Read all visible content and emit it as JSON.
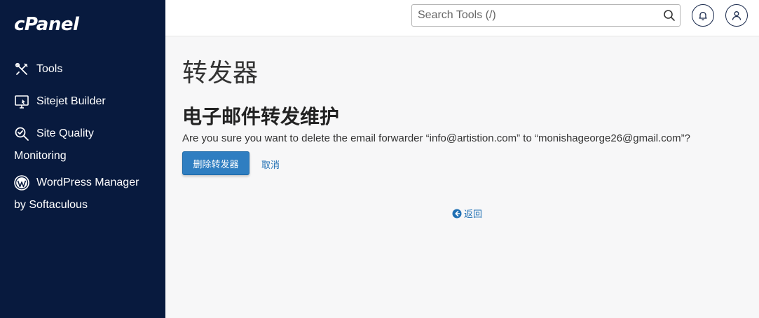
{
  "brand": {
    "logo_text": "cPanel"
  },
  "sidebar": {
    "items": [
      {
        "label": "Tools",
        "icon": "tools-icon"
      },
      {
        "label": "Sitejet Builder",
        "icon": "monitor-icon"
      },
      {
        "label": "Site Quality",
        "label_line2": "Monitoring",
        "icon": "magnifier-check-icon"
      },
      {
        "label": "WordPress Manager",
        "label_line2": "by Softaculous",
        "icon": "wordpress-icon"
      }
    ]
  },
  "header": {
    "search_placeholder": "Search Tools (/)",
    "icons": [
      "search-icon",
      "bell-icon",
      "user-icon"
    ]
  },
  "main": {
    "page_title": "转发器",
    "section_title": "电子邮件转发维护",
    "confirm_text": "Are you sure you want to delete the email forwarder “info@artistion.com” to “monishageorge26@gmail.com”?",
    "delete_button": "删除转发器",
    "cancel_link": "取消",
    "back_link": "返回"
  },
  "colors": {
    "sidebar_bg": "#081a3e",
    "primary_button": "#2f7ec1",
    "link": "#1f6fb3"
  }
}
